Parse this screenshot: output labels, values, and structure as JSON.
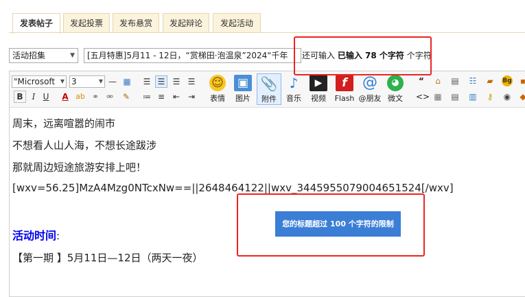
{
  "tabs": [
    {
      "label": "发表帖子",
      "active": true
    },
    {
      "label": "发起投票"
    },
    {
      "label": "发布悬赏"
    },
    {
      "label": "发起辩论"
    },
    {
      "label": "发起活动"
    }
  ],
  "type_select": {
    "value": "活动招集"
  },
  "title": {
    "value": "[五月特惠]5月11 - 12日，“赏梯田·泡温泉”2024“千年",
    "counter_prefix": "还可输入",
    "counter_count": "已输入 78 个字符",
    "counter_suffix": "个字符"
  },
  "toolbar": {
    "font_family": "\"Microsoft",
    "font_size": "3",
    "buttons": {
      "emoji": "表情",
      "image": "图片",
      "attach": "附件",
      "music": "音乐",
      "video": "视频",
      "flash": "Flash",
      "mention": "@朋友",
      "wechat": "微文"
    },
    "small": {
      "bold": "B",
      "italic": "I",
      "underline": "U",
      "font_color": "A",
      "quote": "“",
      "code": "<>",
      "bg": "Bg"
    }
  },
  "content": {
    "lines": [
      "周末，远离喧嚣的闹市",
      "不想看人山人海，不想长途跋涉",
      "那就周边短途旅游安排上吧！",
      "[wxv=56.25]MzA4Mzg0NTcxNw==||2648464122||wxv_3445955079004651524[/wxv]"
    ],
    "section_title": "活动时间",
    "section_colon": ":",
    "period": "【第一期 】5月11日—12日（两天一夜）"
  },
  "error_message": "您的标题超过 100 个字符的限制",
  "colors": {
    "tab_bg": "#fbf3dc",
    "tab_border": "#e6d6ad",
    "error_bg": "#3b7ed6",
    "annotation_red": "#e22",
    "section_title_blue": "#0000ee"
  }
}
